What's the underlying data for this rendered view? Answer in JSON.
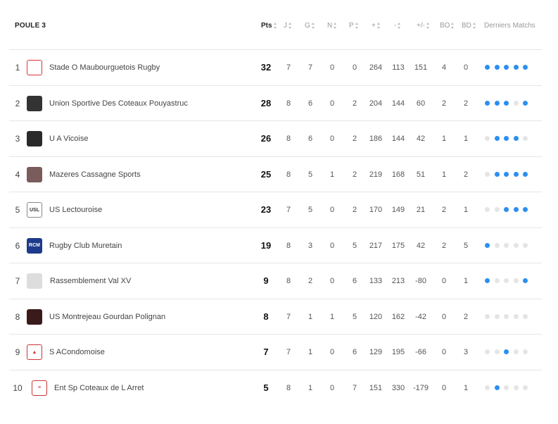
{
  "header": {
    "poule": "POULE 3",
    "columns": [
      "Pts",
      "J",
      "G",
      "N",
      "P",
      "+",
      "-",
      "+/-",
      "BO",
      "BD",
      "Derniers Matchs"
    ]
  },
  "colors": {
    "win": "#2b8ff2",
    "loss": "#e5e5e5"
  },
  "rows": [
    {
      "rank": "1",
      "team": "Stade O Maubourguetois Rugby",
      "pts": "32",
      "j": "7",
      "g": "7",
      "n": "0",
      "p": "0",
      "plus": "264",
      "minus": "113",
      "diff": "151",
      "bo": "4",
      "bd": "0",
      "form": [
        1,
        1,
        1,
        1,
        1
      ],
      "logo_icon": "maubourguet-shield-icon"
    },
    {
      "rank": "2",
      "team": "Union Sportive Des Coteaux Pouyastruc",
      "pts": "28",
      "j": "8",
      "g": "6",
      "n": "0",
      "p": "2",
      "plus": "204",
      "minus": "144",
      "diff": "60",
      "bo": "2",
      "bd": "2",
      "form": [
        1,
        1,
        1,
        0,
        1
      ],
      "logo_icon": "pouyastruc-shield-icon"
    },
    {
      "rank": "3",
      "team": "U A Vicoise",
      "pts": "26",
      "j": "8",
      "g": "6",
      "n": "0",
      "p": "2",
      "plus": "186",
      "minus": "144",
      "diff": "42",
      "bo": "1",
      "bd": "1",
      "form": [
        0,
        1,
        1,
        1,
        0
      ],
      "logo_icon": "vicoise-shield-icon"
    },
    {
      "rank": "4",
      "team": "Mazeres Cassagne Sports",
      "pts": "25",
      "j": "8",
      "g": "5",
      "n": "1",
      "p": "2",
      "plus": "219",
      "minus": "168",
      "diff": "51",
      "bo": "1",
      "bd": "2",
      "form": [
        0,
        1,
        1,
        1,
        1
      ],
      "logo_icon": "mazeres-shield-icon"
    },
    {
      "rank": "5",
      "team": "US Lectouroise",
      "pts": "23",
      "j": "7",
      "g": "5",
      "n": "0",
      "p": "2",
      "plus": "170",
      "minus": "149",
      "diff": "21",
      "bo": "2",
      "bd": "1",
      "form": [
        0,
        0,
        1,
        1,
        1
      ],
      "logo_icon": "lectouroise-logo-icon"
    },
    {
      "rank": "6",
      "team": "Rugby Club Muretain",
      "pts": "19",
      "j": "8",
      "g": "3",
      "n": "0",
      "p": "5",
      "plus": "217",
      "minus": "175",
      "diff": "42",
      "bo": "2",
      "bd": "5",
      "form": [
        1,
        0,
        0,
        0,
        0
      ],
      "logo_icon": "rcm-logo-icon"
    },
    {
      "rank": "7",
      "team": "Rassemblement Val XV",
      "pts": "9",
      "j": "8",
      "g": "2",
      "n": "0",
      "p": "6",
      "plus": "133",
      "minus": "213",
      "diff": "-80",
      "bo": "0",
      "bd": "1",
      "form": [
        1,
        0,
        0,
        0,
        1
      ],
      "logo_icon": "placeholder-shield-icon"
    },
    {
      "rank": "8",
      "team": "US Montrejeau Gourdan Polignan",
      "pts": "8",
      "j": "7",
      "g": "1",
      "n": "1",
      "p": "5",
      "plus": "120",
      "minus": "162",
      "diff": "-42",
      "bo": "0",
      "bd": "2",
      "form": [
        0,
        0,
        0,
        0,
        0
      ],
      "logo_icon": "montrejeau-shield-icon"
    },
    {
      "rank": "9",
      "team": "S ACondomoise",
      "pts": "7",
      "j": "7",
      "g": "1",
      "n": "0",
      "p": "6",
      "plus": "129",
      "minus": "195",
      "diff": "-66",
      "bo": "0",
      "bd": "3",
      "form": [
        0,
        0,
        1,
        0,
        0
      ],
      "logo_icon": "condomoise-shield-icon"
    },
    {
      "rank": "10",
      "team": "Ent Sp Coteaux de L Arret",
      "pts": "5",
      "j": "8",
      "g": "1",
      "n": "0",
      "p": "7",
      "plus": "151",
      "minus": "330",
      "diff": "-179",
      "bo": "0",
      "bd": "1",
      "form": [
        0,
        1,
        0,
        0,
        0
      ],
      "logo_icon": "coteaux-arret-shield-icon"
    }
  ]
}
